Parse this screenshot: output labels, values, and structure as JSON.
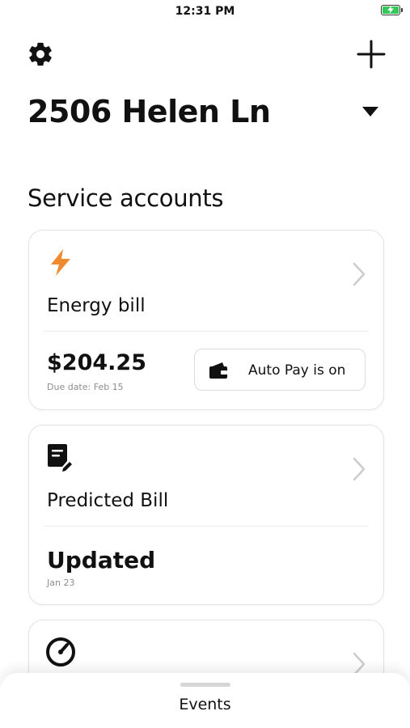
{
  "status_bar": {
    "time": "12:31 PM",
    "battery_icon": "battery-charging-icon"
  },
  "header": {
    "settings_icon": "gear-icon",
    "add_icon": "plus-icon",
    "address": "2506 Helen Ln",
    "dropdown_icon": "caret-down-icon"
  },
  "section_title": "Service accounts",
  "accounts": [
    {
      "icon": "lightning-bolt-icon",
      "label": "Energy bill",
      "amount": "$204.25",
      "due_date": "Due date: Feb 15",
      "autopay_label": "Auto Pay is on",
      "autopay_icon": "wallet-icon",
      "accent_color": "#f08a2e"
    },
    {
      "icon": "document-edit-icon",
      "label": "Predicted Bill",
      "status": "Updated",
      "status_date": "Jan 23"
    },
    {
      "icon": "gauge-icon"
    }
  ],
  "bottom_sheet": {
    "label": "Events"
  },
  "colors": {
    "accent": "#f08a2e",
    "battery": "#34c759",
    "text": "#111111",
    "muted": "#8d8d8d"
  }
}
